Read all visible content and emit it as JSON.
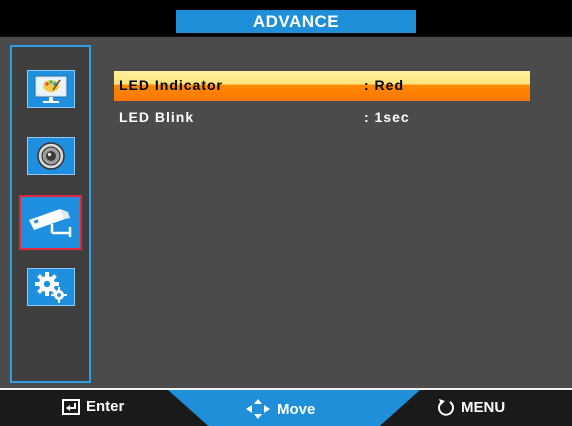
{
  "header": {
    "title": "ADVANCE"
  },
  "sidebar": {
    "items": [
      {
        "name": "picture",
        "icon": "picture-icon"
      },
      {
        "name": "audio",
        "icon": "speaker-icon"
      },
      {
        "name": "advance",
        "icon": "security-camera-icon",
        "active": true
      },
      {
        "name": "setup",
        "icon": "gears-icon"
      }
    ]
  },
  "menu": {
    "rows": [
      {
        "label": "LED Indicator",
        "value": ": Red",
        "selected": true
      },
      {
        "label": "LED Blink",
        "value": ": 1sec",
        "selected": false
      }
    ]
  },
  "footer": {
    "enter_label": "Enter",
    "move_label": "Move",
    "menu_label": "MENU"
  },
  "colors": {
    "accent": "#1e8fd8",
    "highlight": "#ff8a00",
    "active_border": "#e0283c"
  }
}
